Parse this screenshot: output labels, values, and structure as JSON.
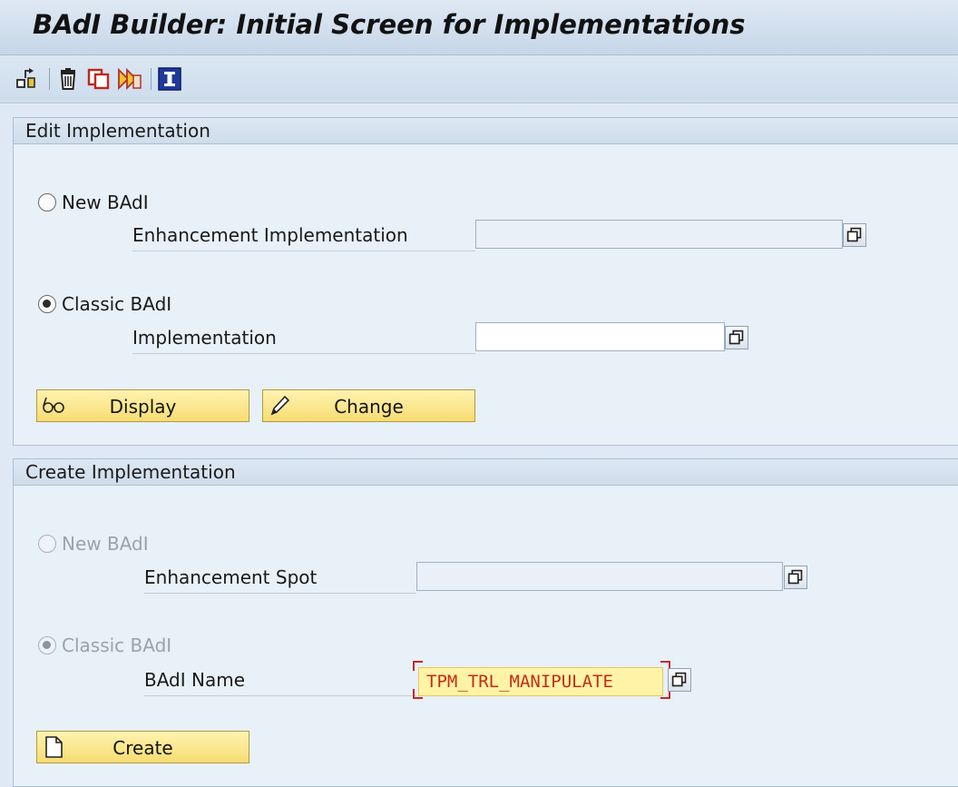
{
  "window": {
    "title": "BAdI Builder: Initial Screen for Implementations"
  },
  "toolbar": {
    "icons": [
      "other-object-icon",
      "delete-icon",
      "copy-icon",
      "rename-icon",
      "information-icon"
    ]
  },
  "edit_panel": {
    "header": "Edit Implementation",
    "new_badi": {
      "label": "New BAdI",
      "selected": false,
      "field_label": "Enhancement Implementation",
      "value": ""
    },
    "classic_badi": {
      "label": "Classic BAdI",
      "selected": true,
      "field_label": "Implementation",
      "value": ""
    },
    "display_label": "Display",
    "change_label": "Change"
  },
  "create_panel": {
    "header": "Create Implementation",
    "new_badi": {
      "label": "New BAdI",
      "selected": false,
      "enabled": false,
      "field_label": "Enhancement Spot",
      "value": ""
    },
    "classic_badi": {
      "label": "Classic BAdI",
      "selected": true,
      "enabled": false,
      "field_label": "BAdI Name",
      "value": "TPM_TRL_MANIPULATE"
    },
    "create_label": "Create"
  },
  "colors": {
    "button_yellow": "#f6dc72",
    "highlight_input": "#fff3a6",
    "input_text": "#c52d14",
    "panel_background": "#e8f0f8"
  }
}
